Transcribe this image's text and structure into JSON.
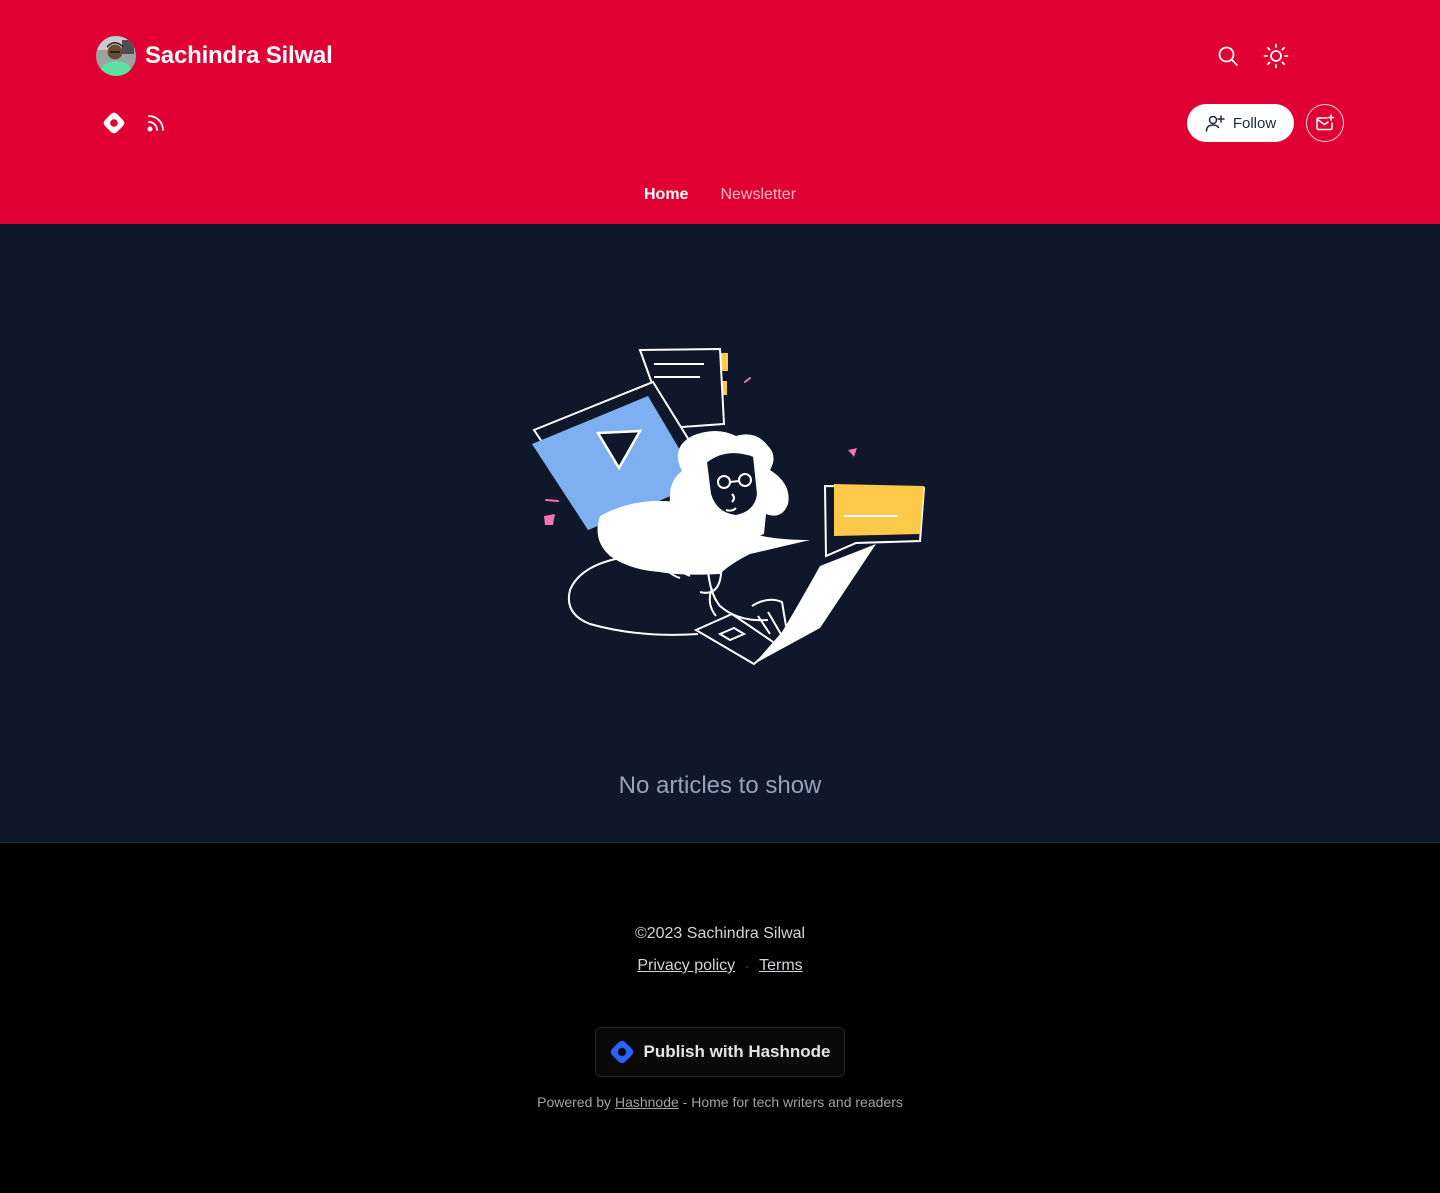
{
  "header": {
    "blog_title": "Sachindra Silwal",
    "follow_label": "Follow",
    "background_color": "#e00034"
  },
  "nav": {
    "items": [
      {
        "label": "Home",
        "active": true
      },
      {
        "label": "Newsletter",
        "active": false
      }
    ]
  },
  "main": {
    "empty_state_text": "No articles to show"
  },
  "footer": {
    "copyright": "©2023 Sachindra Silwal",
    "privacy_label": "Privacy policy",
    "separator": "·",
    "terms_label": "Terms",
    "publish_label": "Publish with Hashnode",
    "powered_prefix": "Powered by",
    "powered_link": "Hashnode",
    "powered_suffix": "- Home for tech writers and readers"
  },
  "icons": {
    "search": "search-icon",
    "theme": "sun-icon",
    "hashnode": "hashnode-icon",
    "rss": "rss-icon",
    "follow": "user-plus-icon",
    "newsletter": "mail-plus-icon"
  }
}
